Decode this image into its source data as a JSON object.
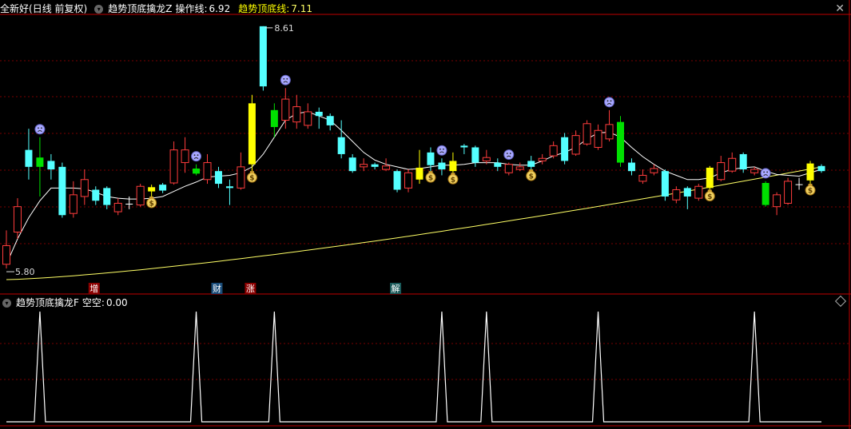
{
  "header": {
    "stock_name": "全新好",
    "period": "(日线 前复权)",
    "indicator_name": "趋势顶底擒龙Z",
    "op_line_label": "操作线:",
    "op_line_value": "6.92",
    "trend_label": "趋势顶底线:",
    "trend_value": "7.11",
    "close_symbol": "✕"
  },
  "sub_header": {
    "indicator_name": "趋势顶底擒龙F",
    "label": "空空:",
    "value": "0.00"
  },
  "colors": {
    "up": "#ff3c3c",
    "down": "#54ffff",
    "signal_yellow": "#ffff00",
    "signal_green": "#00e000",
    "ma_white": "#ffffff",
    "trend_yellow": "#ffff66",
    "grid": "#7a0000",
    "divider": "#c00000"
  },
  "chart_data": {
    "type": "candlestick",
    "annotations": {
      "high_label": "8.61",
      "low_label": "5.80"
    },
    "candles": [
      {
        "o": 5.8,
        "c": 6.02,
        "h": 6.2,
        "l": 5.75,
        "t": "up"
      },
      {
        "o": 6.18,
        "c": 6.48,
        "h": 6.58,
        "l": 6.1,
        "t": "up"
      },
      {
        "o": 7.15,
        "c": 6.95,
        "h": 7.4,
        "l": 6.8,
        "t": "down"
      },
      {
        "o": 7.06,
        "c": 6.95,
        "h": 7.3,
        "l": 6.6,
        "t": "sig_green"
      },
      {
        "o": 7.02,
        "c": 6.92,
        "h": 7.1,
        "l": 6.8,
        "t": "down"
      },
      {
        "o": 6.95,
        "c": 6.38,
        "h": 7.0,
        "l": 6.35,
        "t": "down"
      },
      {
        "o": 6.4,
        "c": 6.62,
        "h": 6.78,
        "l": 6.35,
        "t": "up"
      },
      {
        "o": 6.6,
        "c": 6.8,
        "h": 6.92,
        "l": 6.5,
        "t": "up"
      },
      {
        "o": 6.68,
        "c": 6.55,
        "h": 6.72,
        "l": 6.5,
        "t": "down"
      },
      {
        "o": 6.7,
        "c": 6.5,
        "h": 6.72,
        "l": 6.45,
        "t": "down"
      },
      {
        "o": 6.42,
        "c": 6.52,
        "h": 6.58,
        "l": 6.38,
        "t": "up"
      },
      {
        "o": 6.5,
        "c": 6.51,
        "h": 6.6,
        "l": 6.45,
        "t": "doji"
      },
      {
        "o": 6.5,
        "c": 6.72,
        "h": 6.75,
        "l": 6.48,
        "t": "up"
      },
      {
        "o": 6.66,
        "c": 6.71,
        "h": 6.74,
        "l": 6.6,
        "t": "sig_yellow"
      },
      {
        "o": 6.74,
        "c": 6.67,
        "h": 6.76,
        "l": 6.64,
        "t": "down"
      },
      {
        "o": 6.76,
        "c": 7.15,
        "h": 7.25,
        "l": 6.74,
        "t": "up"
      },
      {
        "o": 7.15,
        "c": 7.0,
        "h": 7.3,
        "l": 6.88,
        "t": "up"
      },
      {
        "o": 6.93,
        "c": 6.87,
        "h": 6.98,
        "l": 6.85,
        "t": "sig_green"
      },
      {
        "o": 6.8,
        "c": 7.0,
        "h": 7.1,
        "l": 6.75,
        "t": "up"
      },
      {
        "o": 6.9,
        "c": 6.75,
        "h": 6.95,
        "l": 6.7,
        "t": "down"
      },
      {
        "o": 6.72,
        "c": 6.7,
        "h": 6.8,
        "l": 6.5,
        "t": "down"
      },
      {
        "o": 6.7,
        "c": 6.95,
        "h": 7.12,
        "l": 6.68,
        "t": "up"
      },
      {
        "o": 6.98,
        "c": 7.7,
        "h": 7.8,
        "l": 6.9,
        "t": "sig_yellow"
      },
      {
        "o": 7.9,
        "c": 8.61,
        "h": 8.61,
        "l": 7.85,
        "t": "down"
      },
      {
        "o": 7.62,
        "c": 7.42,
        "h": 7.7,
        "l": 7.3,
        "t": "sig_green"
      },
      {
        "o": 7.5,
        "c": 7.75,
        "h": 7.88,
        "l": 7.4,
        "t": "up"
      },
      {
        "o": 7.48,
        "c": 7.66,
        "h": 7.8,
        "l": 7.4,
        "t": "up"
      },
      {
        "o": 7.44,
        "c": 7.6,
        "h": 7.7,
        "l": 7.4,
        "t": "up"
      },
      {
        "o": 7.6,
        "c": 7.55,
        "h": 7.65,
        "l": 7.4,
        "t": "down"
      },
      {
        "o": 7.55,
        "c": 7.44,
        "h": 7.58,
        "l": 7.38,
        "t": "down"
      },
      {
        "o": 7.3,
        "c": 7.1,
        "h": 7.5,
        "l": 7.05,
        "t": "down"
      },
      {
        "o": 7.06,
        "c": 6.9,
        "h": 7.1,
        "l": 6.88,
        "t": "down"
      },
      {
        "o": 6.95,
        "c": 6.98,
        "h": 7.05,
        "l": 6.9,
        "t": "up"
      },
      {
        "o": 6.98,
        "c": 6.95,
        "h": 7.0,
        "l": 6.92,
        "t": "down"
      },
      {
        "o": 6.92,
        "c": 6.96,
        "h": 7.05,
        "l": 6.9,
        "t": "up"
      },
      {
        "o": 6.9,
        "c": 6.68,
        "h": 6.92,
        "l": 6.65,
        "t": "down"
      },
      {
        "o": 6.7,
        "c": 6.88,
        "h": 6.92,
        "l": 6.65,
        "t": "up"
      },
      {
        "o": 6.8,
        "c": 6.94,
        "h": 7.15,
        "l": 6.75,
        "t": "sig_yellow"
      },
      {
        "o": 7.12,
        "c": 6.97,
        "h": 7.18,
        "l": 6.9,
        "t": "down"
      },
      {
        "o": 7.0,
        "c": 6.92,
        "h": 7.05,
        "l": 6.85,
        "t": "down"
      },
      {
        "o": 6.9,
        "c": 7.02,
        "h": 7.12,
        "l": 6.88,
        "t": "sig_yellow"
      },
      {
        "o": 7.2,
        "c": 7.18,
        "h": 7.22,
        "l": 7.1,
        "t": "down"
      },
      {
        "o": 7.18,
        "c": 7.0,
        "h": 7.2,
        "l": 6.95,
        "t": "down"
      },
      {
        "o": 7.02,
        "c": 7.06,
        "h": 7.15,
        "l": 6.98,
        "t": "up"
      },
      {
        "o": 7.0,
        "c": 6.95,
        "h": 7.05,
        "l": 6.9,
        "t": "down"
      },
      {
        "o": 6.88,
        "c": 6.98,
        "h": 7.0,
        "l": 6.85,
        "t": "up"
      },
      {
        "o": 6.92,
        "c": 6.95,
        "h": 7.0,
        "l": 6.9,
        "t": "up"
      },
      {
        "o": 7.02,
        "c": 6.95,
        "h": 7.08,
        "l": 6.92,
        "t": "down"
      },
      {
        "o": 7.02,
        "c": 7.05,
        "h": 7.1,
        "l": 6.98,
        "t": "up"
      },
      {
        "o": 7.08,
        "c": 7.2,
        "h": 7.25,
        "l": 7.05,
        "t": "up"
      },
      {
        "o": 7.3,
        "c": 7.02,
        "h": 7.35,
        "l": 6.98,
        "t": "down"
      },
      {
        "o": 7.1,
        "c": 7.32,
        "h": 7.38,
        "l": 7.08,
        "t": "up"
      },
      {
        "o": 7.22,
        "c": 7.46,
        "h": 7.5,
        "l": 7.2,
        "t": "up"
      },
      {
        "o": 7.38,
        "c": 7.18,
        "h": 7.45,
        "l": 7.15,
        "t": "up"
      },
      {
        "o": 7.28,
        "c": 7.45,
        "h": 7.62,
        "l": 7.25,
        "t": "up"
      },
      {
        "o": 7.48,
        "c": 7.0,
        "h": 7.55,
        "l": 6.95,
        "t": "sig_green"
      },
      {
        "o": 7.0,
        "c": 6.9,
        "h": 7.05,
        "l": 6.85,
        "t": "down"
      },
      {
        "o": 6.85,
        "c": 6.78,
        "h": 6.92,
        "l": 6.75,
        "t": "up"
      },
      {
        "o": 6.88,
        "c": 6.93,
        "h": 6.98,
        "l": 6.85,
        "t": "up"
      },
      {
        "o": 6.9,
        "c": 6.6,
        "h": 6.92,
        "l": 6.55,
        "t": "down"
      },
      {
        "o": 6.56,
        "c": 6.68,
        "h": 6.72,
        "l": 6.52,
        "t": "up"
      },
      {
        "o": 6.7,
        "c": 6.6,
        "h": 6.72,
        "l": 6.45,
        "t": "down"
      },
      {
        "o": 6.58,
        "c": 6.72,
        "h": 6.75,
        "l": 6.55,
        "t": "up"
      },
      {
        "o": 6.7,
        "c": 6.94,
        "h": 6.96,
        "l": 6.68,
        "t": "sig_yellow"
      },
      {
        "o": 6.8,
        "c": 7.0,
        "h": 7.08,
        "l": 6.78,
        "t": "up"
      },
      {
        "o": 6.9,
        "c": 7.05,
        "h": 7.12,
        "l": 6.88,
        "t": "up"
      },
      {
        "o": 7.1,
        "c": 6.92,
        "h": 7.12,
        "l": 6.88,
        "t": "down"
      },
      {
        "o": 6.88,
        "c": 6.92,
        "h": 6.95,
        "l": 6.85,
        "t": "up"
      },
      {
        "o": 6.76,
        "c": 6.5,
        "h": 6.78,
        "l": 6.48,
        "t": "sig_green"
      },
      {
        "o": 6.48,
        "c": 6.62,
        "h": 6.65,
        "l": 6.38,
        "t": "up"
      },
      {
        "o": 6.52,
        "c": 6.78,
        "h": 6.82,
        "l": 6.5,
        "t": "up"
      },
      {
        "o": 6.73,
        "c": 6.74,
        "h": 6.82,
        "l": 6.68,
        "t": "doji"
      },
      {
        "o": 6.79,
        "c": 6.99,
        "h": 7.02,
        "l": 6.75,
        "t": "sig_yellow"
      },
      {
        "o": 6.9,
        "c": 6.96,
        "h": 6.98,
        "l": 6.88,
        "t": "down"
      }
    ],
    "ma": [
      5.8,
      6.1,
      6.35,
      6.55,
      6.7,
      6.7,
      6.7,
      6.69,
      6.65,
      6.6,
      6.58,
      6.57,
      6.57,
      6.58,
      6.6,
      6.66,
      6.72,
      6.77,
      6.83,
      6.84,
      6.85,
      6.88,
      6.95,
      7.1,
      7.3,
      7.5,
      7.58,
      7.6,
      7.55,
      7.5,
      7.38,
      7.25,
      7.12,
      7.03,
      6.98,
      6.95,
      6.92,
      6.93,
      6.95,
      6.97,
      6.97,
      6.98,
      7.0,
      7.0,
      7.0,
      6.98,
      6.97,
      6.97,
      7.02,
      7.08,
      7.12,
      7.18,
      7.28,
      7.35,
      7.36,
      7.3,
      7.18,
      7.07,
      6.98,
      6.9,
      6.85,
      6.8,
      6.8,
      6.82,
      6.88,
      6.92,
      6.94,
      6.95,
      6.9,
      6.86,
      6.85,
      6.84,
      6.88,
      6.92
    ],
    "trend_ymin": 4.3,
    "trend_ymax": 6.95,
    "sub_signal_indices": [
      3,
      17,
      24,
      39,
      43,
      53,
      67
    ],
    "events": [
      {
        "index": 8,
        "label": "增"
      },
      {
        "index": 19,
        "label": "财"
      },
      {
        "index": 22,
        "label": "涨"
      },
      {
        "index": 35,
        "label": "解"
      }
    ],
    "face_icons": [
      3,
      17,
      25,
      39,
      45,
      54,
      68
    ],
    "money_icons": [
      13,
      22,
      38,
      40,
      47,
      63,
      72
    ],
    "sub": {
      "ymin": 0,
      "ymax": 1,
      "label_value": "0.00"
    }
  }
}
